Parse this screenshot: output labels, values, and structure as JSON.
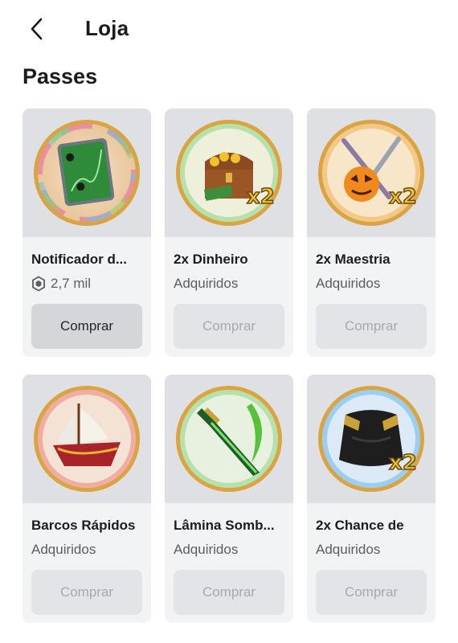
{
  "header": {
    "title": "Loja",
    "back_icon": "chevron-left-icon"
  },
  "section": {
    "title": "Passes"
  },
  "items": [
    {
      "name": "Notificador d...",
      "status": "",
      "price": "2,7 mil",
      "button": "Comprar",
      "enabled": true,
      "icon": "robux-icon"
    },
    {
      "name": "2x Dinheiro",
      "status": "Adquiridos",
      "price": "",
      "button": "Comprar",
      "enabled": false
    },
    {
      "name": "2x Maestria",
      "status": "Adquiridos",
      "price": "",
      "button": "Comprar",
      "enabled": false
    },
    {
      "name": "Barcos Rápidos",
      "status": "Adquiridos",
      "price": "",
      "button": "Comprar",
      "enabled": false
    },
    {
      "name": "Lâmina Somb...",
      "status": "Adquiridos",
      "price": "",
      "button": "Comprar",
      "enabled": false
    },
    {
      "name": "2x Chance de",
      "status": "Adquiridos",
      "price": "",
      "button": "Comprar",
      "enabled": false
    }
  ],
  "badge_text": "x2",
  "colors": {
    "card_bg": "#f2f3f5",
    "thumb_bg": "#dfe0e4",
    "button_active_bg": "#d4d6da",
    "button_disabled_bg": "#e3e4e8",
    "badge_gold": "#f2c12e"
  }
}
